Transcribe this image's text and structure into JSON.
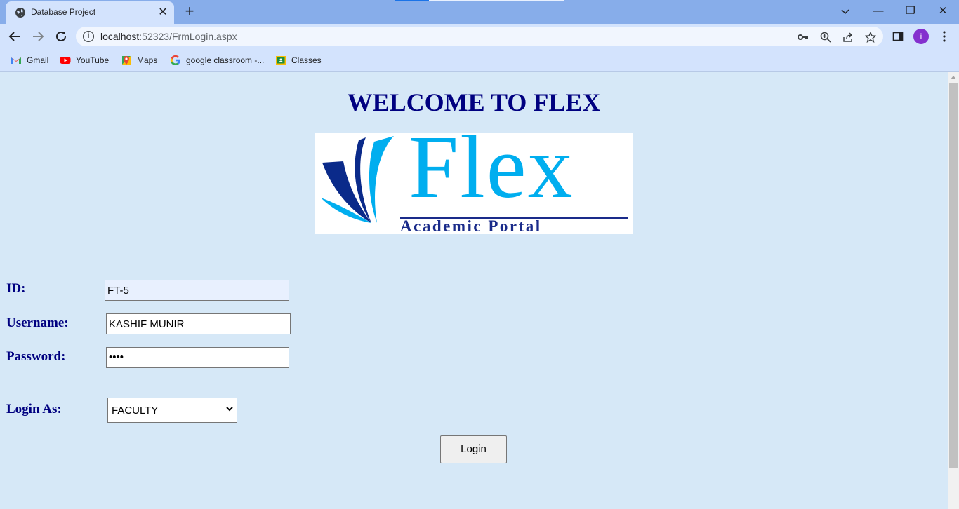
{
  "browser": {
    "tab_title": "Database Project",
    "tab_close": "✕",
    "new_tab": "+",
    "url_host": "localhost",
    "url_path": ":52323/FrmLogin.aspx",
    "profile_initial": "i",
    "window_controls": {
      "minimize": "—",
      "restore": "❐",
      "close": "✕"
    },
    "bookmarks": [
      {
        "label": "Gmail",
        "icon": "gmail-icon"
      },
      {
        "label": "YouTube",
        "icon": "youtube-icon"
      },
      {
        "label": "Maps",
        "icon": "maps-icon"
      },
      {
        "label": "google classroom -...",
        "icon": "google-icon"
      },
      {
        "label": "Classes",
        "icon": "classroom-icon"
      }
    ]
  },
  "page": {
    "heading": "WELCOME TO FLEX",
    "logo": {
      "name": "Flex",
      "tagline": "Academic Portal"
    },
    "form": {
      "id_label": "ID:",
      "id_value": "FT-5",
      "username_label": "Username:",
      "username_value": "KASHIF MUNIR",
      "password_label": "Password:",
      "password_value": "••••",
      "login_as_label": "Login As:",
      "login_as_selected": "FACULTY",
      "login_button": "Login"
    }
  },
  "colors": {
    "page_bg": "#d6e8f7",
    "heading": "#000080",
    "logo_blue": "#00aeef",
    "logo_navy": "#1a2b8a"
  }
}
